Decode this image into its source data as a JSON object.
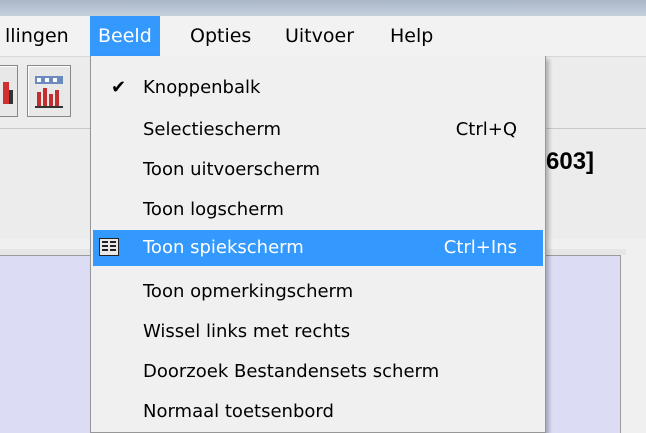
{
  "menubar": {
    "items": [
      {
        "label": "llingen",
        "active": false
      },
      {
        "label": "Beeld",
        "active": true
      },
      {
        "label": "Opties",
        "active": false
      },
      {
        "label": "Uitvoer",
        "active": false
      },
      {
        "label": "Help",
        "active": false
      }
    ]
  },
  "header": {
    "title_fragment": "603]"
  },
  "dropdown": {
    "items": [
      {
        "label": "Knoppenbalk",
        "shortcut": "",
        "checked": true
      },
      {
        "label": "Selectiescherm",
        "shortcut": "Ctrl+Q"
      },
      {
        "label": "Toon uitvoerscherm",
        "shortcut": ""
      },
      {
        "label": "Toon logscherm",
        "shortcut": ""
      },
      {
        "label": "Toon spiekscherm",
        "shortcut": "Ctrl+Ins",
        "highlighted": true,
        "icon": "cheatsheet-icon"
      },
      {
        "label": "Toon opmerkingscherm",
        "shortcut": ""
      },
      {
        "label": "Wissel links met rechts",
        "shortcut": ""
      },
      {
        "label": "Doorzoek Bestandensets scherm",
        "shortcut": ""
      },
      {
        "label": "Normaal toetsenbord",
        "shortcut": ""
      }
    ]
  },
  "colors": {
    "highlight": "#3399ff",
    "panel": "#dcdcf5"
  }
}
